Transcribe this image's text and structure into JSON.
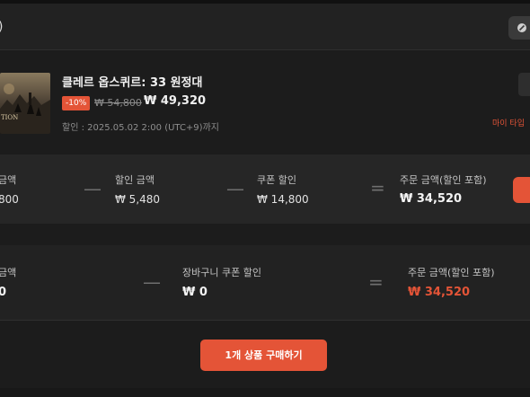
{
  "header": {
    "cut_text": ")"
  },
  "product": {
    "title": "클레르 옵스퀴르: 33 원정대",
    "discount_badge": "-10%",
    "original_price": "₩ 54,800",
    "sale_price": "₩ 49,320",
    "discount_period": "할인 : 2025.05.02 2:00 (UTC+9)까지",
    "thumbnail_text": "TION",
    "side_link": "마이 타입"
  },
  "summary1": {
    "col1_label": "금액",
    "col1_value": "800",
    "col2_label": "할인 금액",
    "col2_value": "₩ 5,480",
    "col3_label": "쿠폰 할인",
    "col3_value": "₩ 14,800",
    "col4_label": "주문 금액(할인 포함)",
    "col4_value": "₩ 34,520",
    "minus1": "—",
    "minus2": "—",
    "equals": "="
  },
  "summary2": {
    "col1_label": "금액",
    "col1_value": "0",
    "col2_label": "장바구니 쿠폰 할인",
    "col2_value": "₩ 0",
    "col3_label": "주문 금액(할인 포함)",
    "col3_value": "₩ 34,520",
    "minus": "—",
    "equals": "="
  },
  "actions": {
    "buy_label": "1개 상품 구매하기"
  },
  "colors": {
    "accent": "#e45437",
    "background": "#1c1c1c",
    "panel": "#262626"
  }
}
